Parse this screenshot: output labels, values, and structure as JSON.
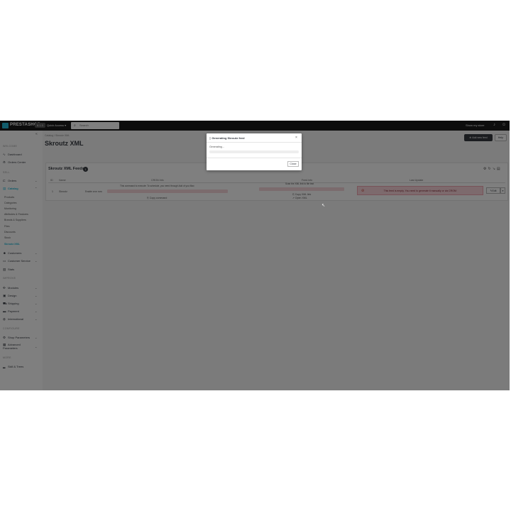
{
  "topbar": {
    "logo": "PRESTASHOP",
    "version": "8.1.5",
    "quick_access": "Quick Access ▾",
    "search_placeholder": "Search",
    "store_link": "Show my store"
  },
  "sidebar": {
    "sections": {
      "sell": "SELL",
      "improve": "IMPROVE",
      "configure": "CONFIGURE",
      "more": "MORE",
      "welcome": "WELCOME"
    },
    "dashboard": "Dashboard",
    "order_center": "Orders Center",
    "orders": "Orders",
    "catalog": "Catalog",
    "catalog_sub": [
      "Products",
      "Categories",
      "Monitoring",
      "Attributes & Features",
      "Brands & Suppliers",
      "Files",
      "Discounts",
      "Stock",
      "Skroutz XML"
    ],
    "customers": "Customers",
    "customer_service": "Customer Service",
    "stats": "Stats",
    "modules": "Modules",
    "design": "Design",
    "shipping": "Shipping",
    "payment": "Payment",
    "international": "International",
    "shop_parameters": "Shop Parameters",
    "advanced_parameters": "Advanced Parameters",
    "kpi": "Skill & Trees"
  },
  "page": {
    "breadcrumb": "Catalog  /  Skroutz XML",
    "title": "Skroutz XML",
    "add_button": "Add new feed",
    "help_button": "Help"
  },
  "card": {
    "title": "Skroutz XML Feeds",
    "count": "1",
    "headers": [
      "ID",
      "Name",
      "CRON Info",
      "Feed Info",
      "Last Update"
    ],
    "row": {
      "id": "1",
      "name": "Skroutz",
      "cron_label": "Enable cron now",
      "cron_note": "This command to execute: To schedule, you need through Add of you Mac",
      "copy_cron": "Copy command",
      "feed_note": "Scan the XML link to file test",
      "feed_link1": "Copy XML link",
      "feed_link2": "Open XML",
      "alert": "This feed is empty. You need to generate it manually or via CRON!",
      "edit": "Edit"
    }
  },
  "modal": {
    "title": "Generating Skroutz feed",
    "status": "Generating...",
    "progress": 0,
    "close_button": "Close"
  },
  "colors": {
    "accent": "#25b9d7",
    "topbar": "#1a1a1a",
    "alert_bg": "#fbd5da"
  }
}
